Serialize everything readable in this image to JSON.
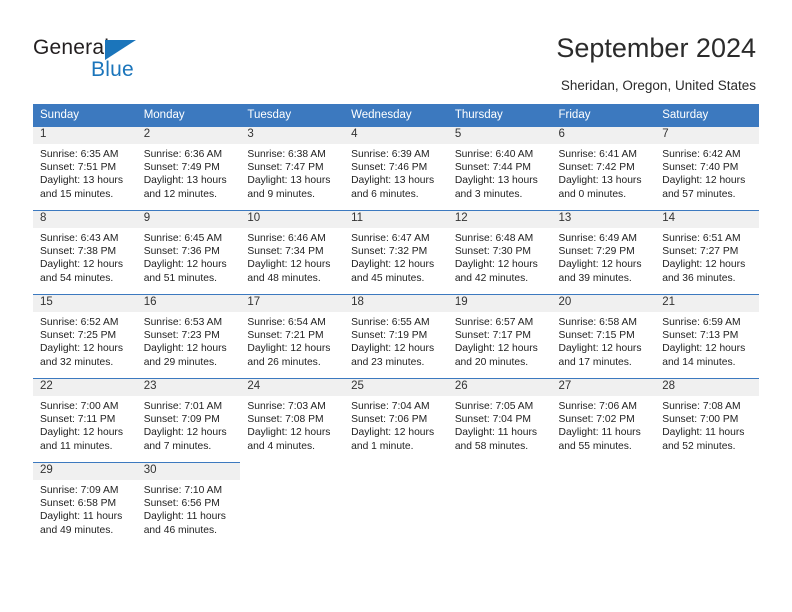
{
  "brand": {
    "name_part1": "General",
    "name_part2": "Blue",
    "accent_color": "#1b75bb"
  },
  "header": {
    "title": "September 2024",
    "location": "Sheridan, Oregon, United States"
  },
  "theme": {
    "header_row_bg": "#3c79bf",
    "daynum_bg": "#f0f0f0",
    "cell_top_border": "#3c79bf"
  },
  "weekdays": [
    "Sunday",
    "Monday",
    "Tuesday",
    "Wednesday",
    "Thursday",
    "Friday",
    "Saturday"
  ],
  "weeks": [
    [
      {
        "day": "1",
        "sunrise": "Sunrise: 6:35 AM",
        "sunset": "Sunset: 7:51 PM",
        "daylight1": "Daylight: 13 hours",
        "daylight2": "and 15 minutes."
      },
      {
        "day": "2",
        "sunrise": "Sunrise: 6:36 AM",
        "sunset": "Sunset: 7:49 PM",
        "daylight1": "Daylight: 13 hours",
        "daylight2": "and 12 minutes."
      },
      {
        "day": "3",
        "sunrise": "Sunrise: 6:38 AM",
        "sunset": "Sunset: 7:47 PM",
        "daylight1": "Daylight: 13 hours",
        "daylight2": "and 9 minutes."
      },
      {
        "day": "4",
        "sunrise": "Sunrise: 6:39 AM",
        "sunset": "Sunset: 7:46 PM",
        "daylight1": "Daylight: 13 hours",
        "daylight2": "and 6 minutes."
      },
      {
        "day": "5",
        "sunrise": "Sunrise: 6:40 AM",
        "sunset": "Sunset: 7:44 PM",
        "daylight1": "Daylight: 13 hours",
        "daylight2": "and 3 minutes."
      },
      {
        "day": "6",
        "sunrise": "Sunrise: 6:41 AM",
        "sunset": "Sunset: 7:42 PM",
        "daylight1": "Daylight: 13 hours",
        "daylight2": "and 0 minutes."
      },
      {
        "day": "7",
        "sunrise": "Sunrise: 6:42 AM",
        "sunset": "Sunset: 7:40 PM",
        "daylight1": "Daylight: 12 hours",
        "daylight2": "and 57 minutes."
      }
    ],
    [
      {
        "day": "8",
        "sunrise": "Sunrise: 6:43 AM",
        "sunset": "Sunset: 7:38 PM",
        "daylight1": "Daylight: 12 hours",
        "daylight2": "and 54 minutes."
      },
      {
        "day": "9",
        "sunrise": "Sunrise: 6:45 AM",
        "sunset": "Sunset: 7:36 PM",
        "daylight1": "Daylight: 12 hours",
        "daylight2": "and 51 minutes."
      },
      {
        "day": "10",
        "sunrise": "Sunrise: 6:46 AM",
        "sunset": "Sunset: 7:34 PM",
        "daylight1": "Daylight: 12 hours",
        "daylight2": "and 48 minutes."
      },
      {
        "day": "11",
        "sunrise": "Sunrise: 6:47 AM",
        "sunset": "Sunset: 7:32 PM",
        "daylight1": "Daylight: 12 hours",
        "daylight2": "and 45 minutes."
      },
      {
        "day": "12",
        "sunrise": "Sunrise: 6:48 AM",
        "sunset": "Sunset: 7:30 PM",
        "daylight1": "Daylight: 12 hours",
        "daylight2": "and 42 minutes."
      },
      {
        "day": "13",
        "sunrise": "Sunrise: 6:49 AM",
        "sunset": "Sunset: 7:29 PM",
        "daylight1": "Daylight: 12 hours",
        "daylight2": "and 39 minutes."
      },
      {
        "day": "14",
        "sunrise": "Sunrise: 6:51 AM",
        "sunset": "Sunset: 7:27 PM",
        "daylight1": "Daylight: 12 hours",
        "daylight2": "and 36 minutes."
      }
    ],
    [
      {
        "day": "15",
        "sunrise": "Sunrise: 6:52 AM",
        "sunset": "Sunset: 7:25 PM",
        "daylight1": "Daylight: 12 hours",
        "daylight2": "and 32 minutes."
      },
      {
        "day": "16",
        "sunrise": "Sunrise: 6:53 AM",
        "sunset": "Sunset: 7:23 PM",
        "daylight1": "Daylight: 12 hours",
        "daylight2": "and 29 minutes."
      },
      {
        "day": "17",
        "sunrise": "Sunrise: 6:54 AM",
        "sunset": "Sunset: 7:21 PM",
        "daylight1": "Daylight: 12 hours",
        "daylight2": "and 26 minutes."
      },
      {
        "day": "18",
        "sunrise": "Sunrise: 6:55 AM",
        "sunset": "Sunset: 7:19 PM",
        "daylight1": "Daylight: 12 hours",
        "daylight2": "and 23 minutes."
      },
      {
        "day": "19",
        "sunrise": "Sunrise: 6:57 AM",
        "sunset": "Sunset: 7:17 PM",
        "daylight1": "Daylight: 12 hours",
        "daylight2": "and 20 minutes."
      },
      {
        "day": "20",
        "sunrise": "Sunrise: 6:58 AM",
        "sunset": "Sunset: 7:15 PM",
        "daylight1": "Daylight: 12 hours",
        "daylight2": "and 17 minutes."
      },
      {
        "day": "21",
        "sunrise": "Sunrise: 6:59 AM",
        "sunset": "Sunset: 7:13 PM",
        "daylight1": "Daylight: 12 hours",
        "daylight2": "and 14 minutes."
      }
    ],
    [
      {
        "day": "22",
        "sunrise": "Sunrise: 7:00 AM",
        "sunset": "Sunset: 7:11 PM",
        "daylight1": "Daylight: 12 hours",
        "daylight2": "and 11 minutes."
      },
      {
        "day": "23",
        "sunrise": "Sunrise: 7:01 AM",
        "sunset": "Sunset: 7:09 PM",
        "daylight1": "Daylight: 12 hours",
        "daylight2": "and 7 minutes."
      },
      {
        "day": "24",
        "sunrise": "Sunrise: 7:03 AM",
        "sunset": "Sunset: 7:08 PM",
        "daylight1": "Daylight: 12 hours",
        "daylight2": "and 4 minutes."
      },
      {
        "day": "25",
        "sunrise": "Sunrise: 7:04 AM",
        "sunset": "Sunset: 7:06 PM",
        "daylight1": "Daylight: 12 hours",
        "daylight2": "and 1 minute."
      },
      {
        "day": "26",
        "sunrise": "Sunrise: 7:05 AM",
        "sunset": "Sunset: 7:04 PM",
        "daylight1": "Daylight: 11 hours",
        "daylight2": "and 58 minutes."
      },
      {
        "day": "27",
        "sunrise": "Sunrise: 7:06 AM",
        "sunset": "Sunset: 7:02 PM",
        "daylight1": "Daylight: 11 hours",
        "daylight2": "and 55 minutes."
      },
      {
        "day": "28",
        "sunrise": "Sunrise: 7:08 AM",
        "sunset": "Sunset: 7:00 PM",
        "daylight1": "Daylight: 11 hours",
        "daylight2": "and 52 minutes."
      }
    ],
    [
      {
        "day": "29",
        "sunrise": "Sunrise: 7:09 AM",
        "sunset": "Sunset: 6:58 PM",
        "daylight1": "Daylight: 11 hours",
        "daylight2": "and 49 minutes."
      },
      {
        "day": "30",
        "sunrise": "Sunrise: 7:10 AM",
        "sunset": "Sunset: 6:56 PM",
        "daylight1": "Daylight: 11 hours",
        "daylight2": "and 46 minutes."
      },
      {
        "day": "",
        "sunrise": "",
        "sunset": "",
        "daylight1": "",
        "daylight2": ""
      },
      {
        "day": "",
        "sunrise": "",
        "sunset": "",
        "daylight1": "",
        "daylight2": ""
      },
      {
        "day": "",
        "sunrise": "",
        "sunset": "",
        "daylight1": "",
        "daylight2": ""
      },
      {
        "day": "",
        "sunrise": "",
        "sunset": "",
        "daylight1": "",
        "daylight2": ""
      },
      {
        "day": "",
        "sunrise": "",
        "sunset": "",
        "daylight1": "",
        "daylight2": ""
      }
    ]
  ]
}
